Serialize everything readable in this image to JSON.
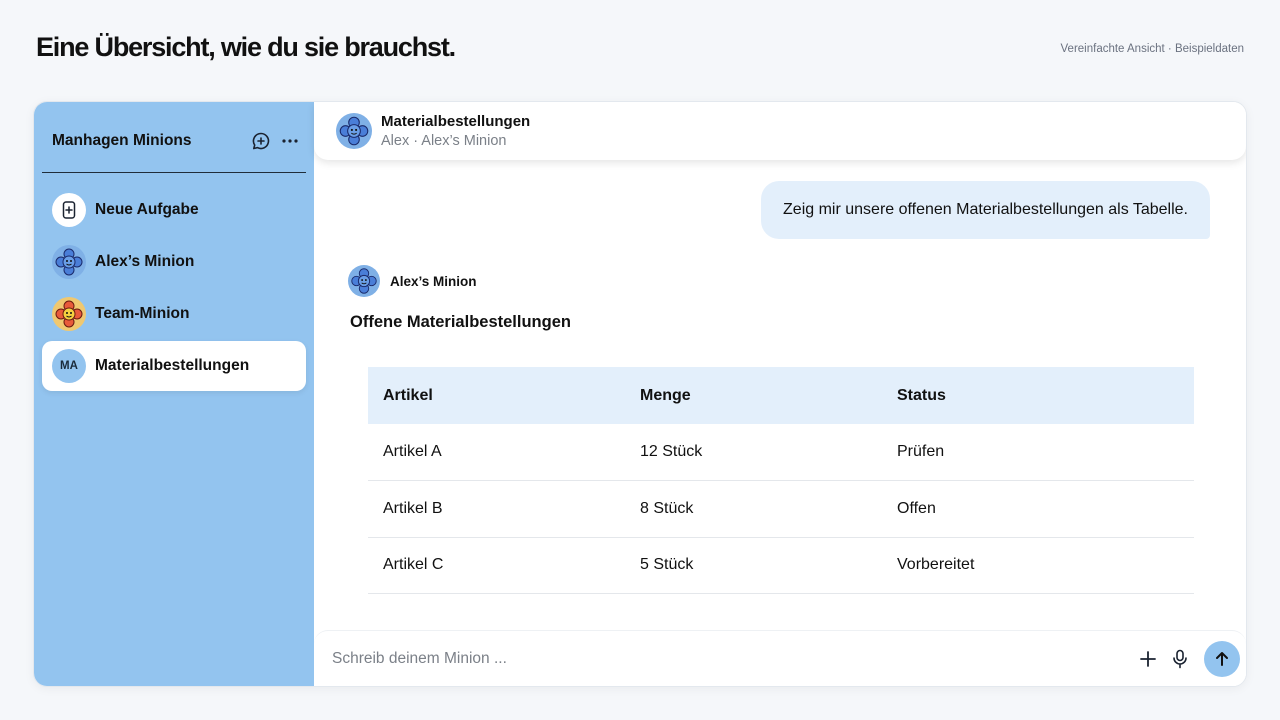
{
  "page": {
    "title": "Eine Übersicht, wie du sie brauchst.",
    "note": "Vereinfachte Ansicht · Beispieldaten"
  },
  "sidebar": {
    "title": "Manhagen Minions",
    "icons": [
      "new-chat-icon",
      "more-icon"
    ],
    "items": [
      {
        "label": "Neue Aufgabe",
        "icon": "new-task-icon"
      },
      {
        "label": "Alex’s Minion",
        "icon": "minion-blue-avatar"
      },
      {
        "label": "Team-Minion",
        "icon": "minion-orange-avatar"
      },
      {
        "label": "Materialbestellungen",
        "initials": "MA",
        "active": true
      }
    ]
  },
  "chat": {
    "header": {
      "title": "Materialbestellungen",
      "subtitle": "Alex · Alex’s Minion"
    },
    "user_message": "Zeig mir unsere offenen Materialbestellungen als Tabelle.",
    "bot": {
      "name": "Alex’s Minion",
      "heading": "Offene Materialbestellungen"
    },
    "table": {
      "headers": [
        "Artikel",
        "Menge",
        "Status"
      ],
      "rows": [
        [
          "Artikel A",
          "12 Stück",
          "Prüfen"
        ],
        [
          "Artikel B",
          "8 Stück",
          "Offen"
        ],
        [
          "Artikel C",
          "5 Stück",
          "Vorbereitet"
        ]
      ]
    },
    "composer": {
      "placeholder": "Schreib deinem Minion ...",
      "icons": [
        "plus-icon",
        "microphone-icon",
        "send-arrow-icon"
      ]
    }
  },
  "colors": {
    "sidebar_bg": "#93c4ef",
    "bubble_bg": "#e3effb",
    "send_button": "#93c4ef",
    "minion_blue": "#4a7ed8",
    "minion_orange": "#e85a3a"
  }
}
